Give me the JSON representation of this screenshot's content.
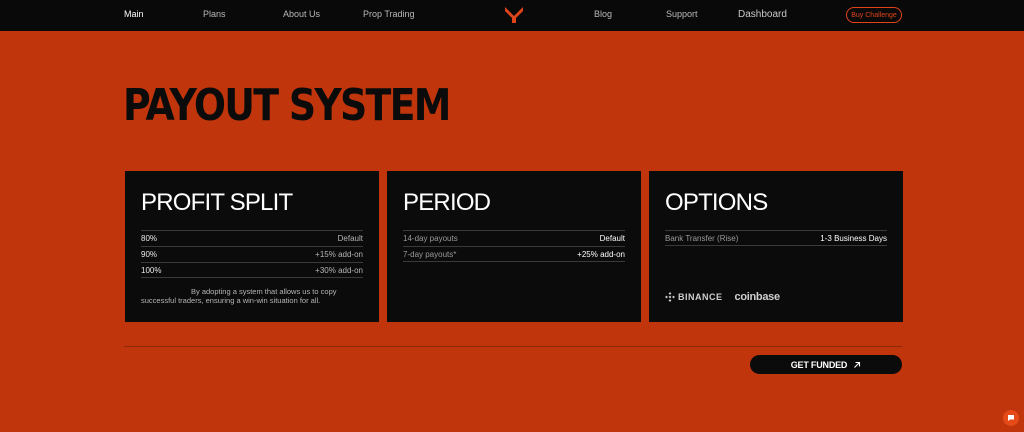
{
  "nav": {
    "main": "Main",
    "plans": "Plans",
    "about": "About Us",
    "prop": "Prop Trading",
    "blog": "Blog",
    "support": "Support",
    "dashboard": "Dashboard",
    "buy_label": "Buy Challenge"
  },
  "page": {
    "title": "PAYOUT SYSTEM"
  },
  "cards": {
    "profit": {
      "title": "PROFIT SPLIT",
      "rows": [
        {
          "left": "80%",
          "right": "Default"
        },
        {
          "left": "90%",
          "right": "+15% add-on"
        },
        {
          "left": "100%",
          "right": "+30% add-on"
        }
      ],
      "description": "By adopting a system that allows us to copy successful traders, ensuring a win-win situation for all."
    },
    "period": {
      "title": "PERIOD",
      "rows": [
        {
          "left": "14-day payouts",
          "right": "Default"
        },
        {
          "left": "7-day payouts*",
          "right": "+25% add-on"
        }
      ]
    },
    "options": {
      "title": "OPTIONS",
      "rows": [
        {
          "left": "Bank Transfer (Rise)",
          "right": "1-3 Business Days"
        }
      ],
      "binance": "BINANCE",
      "coinbase": "coinbase"
    }
  },
  "cta": {
    "label": "GET FUNDED"
  },
  "colors": {
    "background": "#c0350b",
    "card": "#0b0b0b",
    "accent": "#e0441a"
  }
}
